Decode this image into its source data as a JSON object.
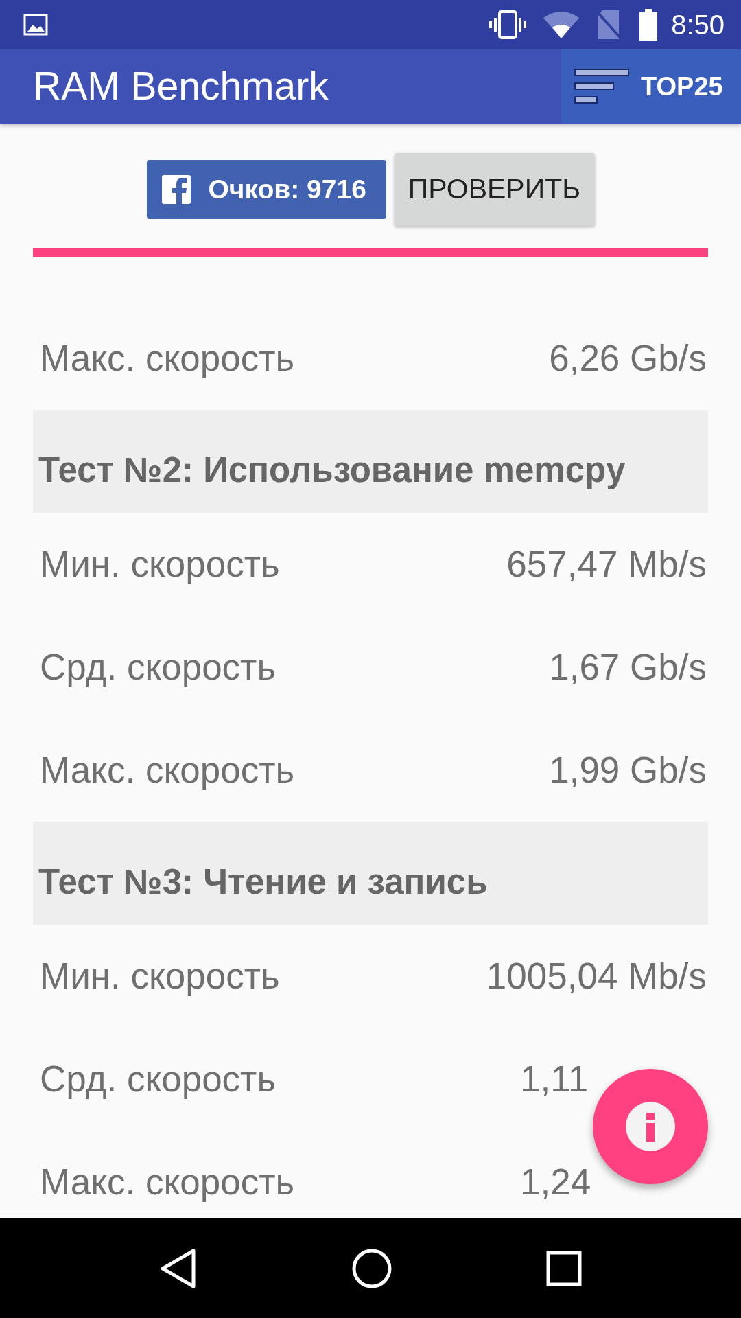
{
  "status_bar": {
    "time": "8:50"
  },
  "app_bar": {
    "title": "RAM Benchmark",
    "action": "TOP25"
  },
  "score_button": {
    "label": "Очков: 9716"
  },
  "check_button": {
    "label": "ПРОВЕРИТЬ"
  },
  "items": [
    {
      "kind": "row",
      "label": "Макс. скорость",
      "value": "6,26 Gb/s"
    },
    {
      "kind": "header",
      "label": "Тест №2: Использование memcpy"
    },
    {
      "kind": "row",
      "label": "Мин. скорость",
      "value": "657,47 Mb/s"
    },
    {
      "kind": "row",
      "label": "Срд. скорость",
      "value": "1,67 Gb/s"
    },
    {
      "kind": "row",
      "label": "Макс. скорость",
      "value": "1,99 Gb/s"
    },
    {
      "kind": "header",
      "label": "Тест №3: Чтение и запись"
    },
    {
      "kind": "row",
      "label": "Мин. скорость",
      "value": "1005,04 Mb/s"
    },
    {
      "kind": "row",
      "label": "Срд. скорость",
      "value": "1,11"
    },
    {
      "kind": "row",
      "label": "Макс. скорость",
      "value": "1,24"
    }
  ]
}
